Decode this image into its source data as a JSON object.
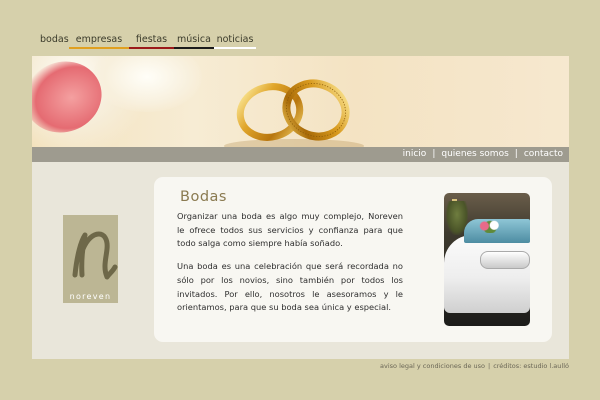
{
  "nav": {
    "items": [
      {
        "label": "bodas",
        "color": ""
      },
      {
        "label": "empresas",
        "color": "#e0a020"
      },
      {
        "label": "fiestas",
        "color": "#9b1a1a"
      },
      {
        "label": "música",
        "color": "#1a1a1a"
      },
      {
        "label": "noticias",
        "color": "#ffffff"
      }
    ]
  },
  "infobar": {
    "links": [
      "inicio",
      "quienes somos",
      "contacto"
    ],
    "separator": "|"
  },
  "logo": {
    "letter": "n",
    "name": "noreven"
  },
  "content": {
    "title": "Bodas",
    "paragraphs": [
      "Organizar una boda es algo muy complejo, Noreven le ofrece todos sus servicios y confianza para que todo salga como siempre había soñado.",
      "Una boda es una celebración que será recordada no sólo por los novios, sino también por todos los invitados. Por ello, nosotros le asesoramos y le orientamos, para que su boda sea única y especial."
    ]
  },
  "footer": {
    "legal": "aviso legal y condiciones de uso",
    "separator": "|",
    "credits": "créditos: estudio l.aulló"
  },
  "colors": {
    "background": "#d6d0ab",
    "infobar": "#9e9b8f",
    "title": "#8a7a50",
    "logo_box": "#bcb694"
  }
}
